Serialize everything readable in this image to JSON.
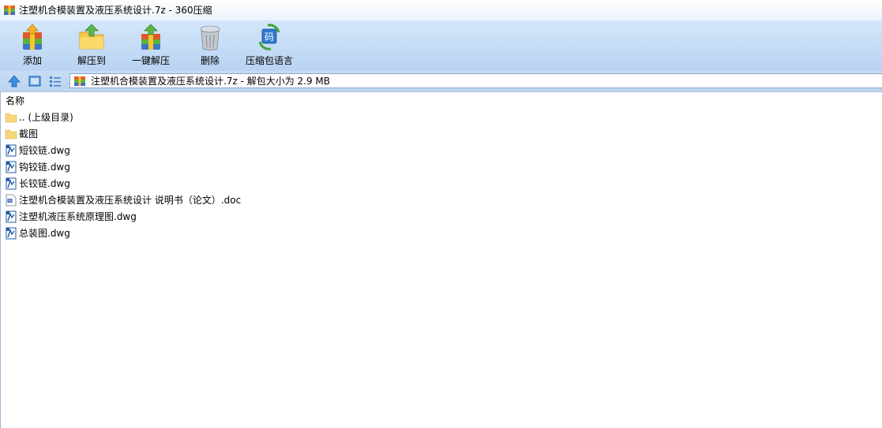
{
  "window": {
    "title": "注塑机合模装置及液压系统设计.7z - 360压缩"
  },
  "toolbar": {
    "buttons": [
      {
        "label": "添加",
        "icon": "add-archive-icon"
      },
      {
        "label": "解压到",
        "icon": "extract-to-icon"
      },
      {
        "label": "一键解压",
        "icon": "one-click-extract-icon"
      },
      {
        "label": "删除",
        "icon": "trash-icon"
      },
      {
        "label": "压缩包语言",
        "icon": "archive-language-icon"
      }
    ]
  },
  "navbar": {
    "address": "注塑机合模装置及液压系统设计.7z - 解包大小为 2.9 MB"
  },
  "list": {
    "column_name": "名称",
    "items": [
      {
        "name": ".. (上级目录)",
        "type": "folder"
      },
      {
        "name": "截图",
        "type": "folder"
      },
      {
        "name": "短铰链.dwg",
        "type": "dwg"
      },
      {
        "name": "钩铰链.dwg",
        "type": "dwg"
      },
      {
        "name": "长铰链.dwg",
        "type": "dwg"
      },
      {
        "name": "注塑机合模装置及液压系统设计 说明书（论文）.doc",
        "type": "doc"
      },
      {
        "name": "注塑机液压系统原理图.dwg",
        "type": "dwg"
      },
      {
        "name": "总装图.dwg",
        "type": "dwg"
      }
    ]
  }
}
